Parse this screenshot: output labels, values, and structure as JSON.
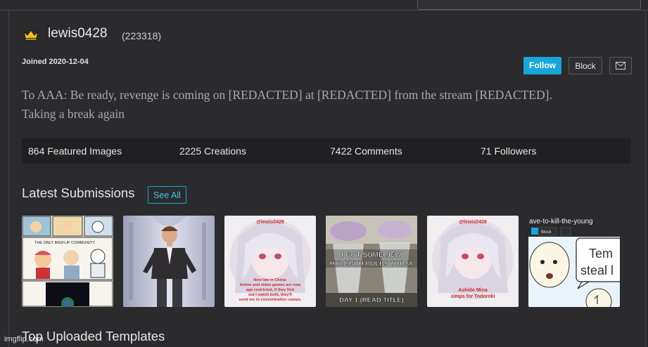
{
  "profile": {
    "username": "lewis0428",
    "points": "(223318)",
    "joined": "Joined 2020-12-04",
    "bio_line1": "To AAA: Be ready, revenge is coming on [REDACTED] at [REDACTED] from the stream [REDACTED].",
    "bio_line2": "Taking a break again"
  },
  "actions": {
    "follow_label": "Follow",
    "block_label": "Block",
    "mail_icon": "mail-icon"
  },
  "stats": {
    "featured": "864 Featured Images",
    "creations": "2225 Creations",
    "comments": "7422 Comments",
    "followers": "71 Followers"
  },
  "latest": {
    "title": "Latest Submissions",
    "see_all": "See All",
    "thumbs": {
      "t1_caption": "THE ONLY IMGFLIP COMMUNITY",
      "t3_user": "@lewis0428",
      "t3_text1": "New law in China:",
      "t3_text2": "Anime and video games are now",
      "t3_text3": "age restricted, if they find",
      "t3_text4": "out I watch both, they'll",
      "t3_text5": "send me to concentration camps.",
      "t4_text1": "I GOT SOME NEW",
      "t4_text2": "HYACINTH BULBS TODAY",
      "t4_text3": "DAY 1 (READ TITLE)",
      "t5_user": "@lewis0428",
      "t5_text1": "Ashido Mina",
      "t5_text2": "simps for Todoroki",
      "t6_header": "ave-to-kill-the-young",
      "t6_block": "Block",
      "t6_bubble1": "Tem",
      "t6_bubble2": "steal l"
    }
  },
  "templates": {
    "title": "Top Uploaded Templates"
  },
  "watermark": "imgflip.com",
  "colors": {
    "background": "#2b2b2d",
    "accent": "#18a5d9",
    "stats_bar": "#202022"
  }
}
